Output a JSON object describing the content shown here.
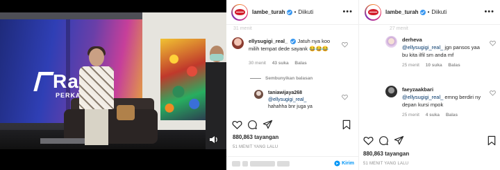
{
  "video": {
    "logo_text": "Raja",
    "logo_sub": "PERKAKA",
    "volume_icon": "volume-icon"
  },
  "panel1": {
    "header": {
      "username": "lambe_turah",
      "follow": "Diikuti"
    },
    "faded_top": "31 menit",
    "comment1": {
      "user": "ellysugigi_real_",
      "text": "Jatuh nya koo milih tempat dede sayank 😂😂😂",
      "time": "30 menit",
      "likes": "43 suka",
      "reply": "Balas"
    },
    "hide_replies": "Sembunyikan balasan",
    "reply1": {
      "user": "taniawijaya268",
      "mention": "@ellysugigi_real_",
      "text": "hahahha bnr juga ya"
    },
    "views": "880,863 tayangan",
    "time_ago": "51 MENIT YANG LALU",
    "send_label": "Kirim"
  },
  "panel2": {
    "header": {
      "username": "lambe_turah",
      "follow": "Diikuti"
    },
    "faded_top": "27 menit",
    "comment1": {
      "user": "derheva",
      "mention": "@ellysugigi_real_",
      "text": "jgn pansos yaa bu kita ilfil sm anda mf",
      "time": "25 menit",
      "likes": "10 suka",
      "reply": "Balas"
    },
    "comment2": {
      "user": "faeyzaakbari",
      "mention": "@ellysugigi_real_",
      "text": "emng berdiri ny depan kursi mpok",
      "time": "25 menit",
      "likes": "4 suka",
      "reply": "Balas"
    },
    "views": "880,863 tayangan",
    "time_ago": "51 MENIT YANG LALU"
  }
}
